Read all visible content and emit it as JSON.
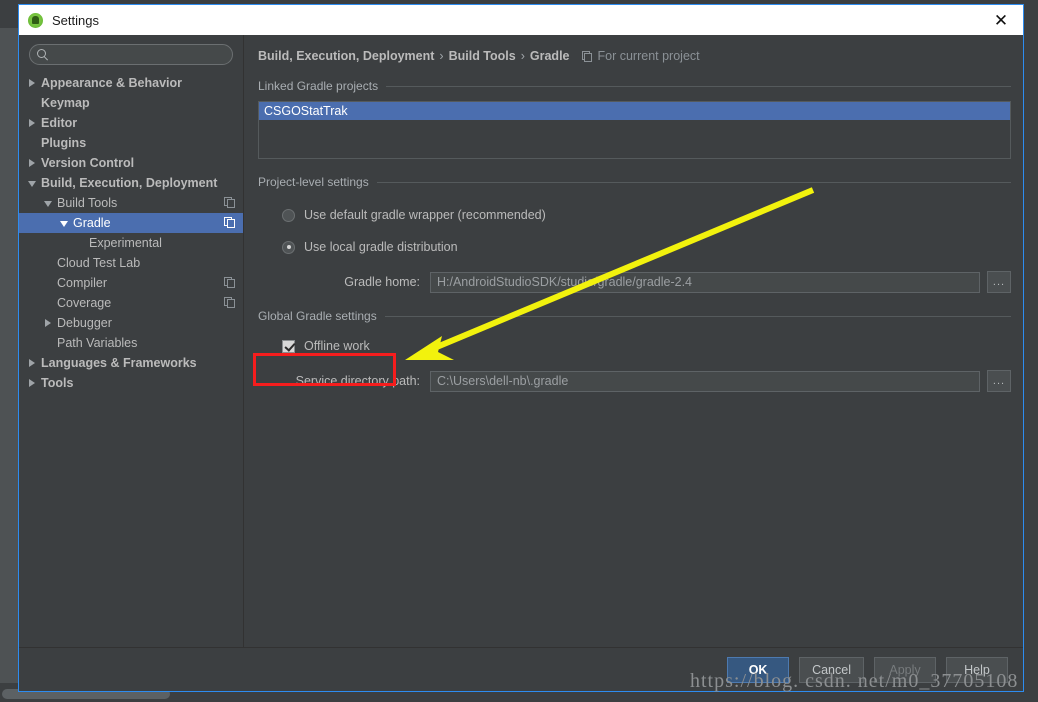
{
  "window": {
    "title": "Settings",
    "app_icon": "android-studio-icon",
    "close_icon": "close-icon",
    "accent_border": "#2d8cf0"
  },
  "search": {
    "icon": "search-icon",
    "value": "",
    "placeholder": ""
  },
  "sidebar": {
    "items": [
      {
        "label": "Appearance & Behavior",
        "indent": 0,
        "arrow": "right",
        "bold": true,
        "copy": false,
        "selected": false
      },
      {
        "label": "Keymap",
        "indent": 0,
        "arrow": "none",
        "bold": true,
        "copy": false,
        "selected": false
      },
      {
        "label": "Editor",
        "indent": 0,
        "arrow": "right",
        "bold": true,
        "copy": false,
        "selected": false
      },
      {
        "label": "Plugins",
        "indent": 0,
        "arrow": "none",
        "bold": true,
        "copy": false,
        "selected": false
      },
      {
        "label": "Version Control",
        "indent": 0,
        "arrow": "right",
        "bold": true,
        "copy": false,
        "selected": false
      },
      {
        "label": "Build, Execution, Deployment",
        "indent": 0,
        "arrow": "down",
        "bold": true,
        "copy": false,
        "selected": false
      },
      {
        "label": "Build Tools",
        "indent": 1,
        "arrow": "down",
        "bold": false,
        "copy": true,
        "selected": false
      },
      {
        "label": "Gradle",
        "indent": 2,
        "arrow": "down",
        "bold": false,
        "copy": true,
        "selected": true
      },
      {
        "label": "Experimental",
        "indent": 3,
        "arrow": "none",
        "bold": false,
        "copy": false,
        "selected": false
      },
      {
        "label": "Cloud Test Lab",
        "indent": 1,
        "arrow": "none",
        "bold": false,
        "copy": false,
        "selected": false
      },
      {
        "label": "Compiler",
        "indent": 1,
        "arrow": "none",
        "bold": false,
        "copy": true,
        "selected": false
      },
      {
        "label": "Coverage",
        "indent": 1,
        "arrow": "none",
        "bold": false,
        "copy": true,
        "selected": false
      },
      {
        "label": "Debugger",
        "indent": 1,
        "arrow": "right",
        "bold": false,
        "copy": false,
        "selected": false
      },
      {
        "label": "Path Variables",
        "indent": 1,
        "arrow": "none",
        "bold": false,
        "copy": false,
        "selected": false
      },
      {
        "label": "Languages & Frameworks",
        "indent": 0,
        "arrow": "right",
        "bold": true,
        "copy": false,
        "selected": false
      },
      {
        "label": "Tools",
        "indent": 0,
        "arrow": "right",
        "bold": true,
        "copy": false,
        "selected": false
      }
    ],
    "selection_color": "#4b6eaf"
  },
  "breadcrumb": {
    "crumbs": [
      "Build, Execution, Deployment",
      "Build Tools",
      "Gradle"
    ],
    "separator": "›",
    "scope_icon": "project-scope-icon",
    "scope_text": "For current project"
  },
  "main": {
    "linked_projects": {
      "section_label": "Linked Gradle projects",
      "items": [
        "CSGOStatTrak"
      ],
      "selected_index": 0
    },
    "project_level": {
      "section_label": "Project-level settings",
      "radios": [
        {
          "label": "Use default gradle wrapper (recommended)",
          "checked": false
        },
        {
          "label": "Use local gradle distribution",
          "checked": true
        }
      ],
      "gradle_home": {
        "label": "Gradle home:",
        "value": "H:/AndroidStudioSDK/studio/gradle/gradle-2.4",
        "browse_label": "...",
        "browse_icon": "ellipsis-icon"
      }
    },
    "global_settings": {
      "section_label": "Global Gradle settings",
      "offline_work": {
        "label": "Offline work",
        "checked": true
      },
      "service_directory": {
        "label": "Service directory path:",
        "value": "C:\\Users\\dell-nb\\.gradle",
        "browse_label": "...",
        "browse_icon": "ellipsis-icon"
      }
    }
  },
  "footer": {
    "buttons": [
      {
        "label": "OK",
        "style": "primary"
      },
      {
        "label": "Cancel",
        "style": "normal"
      },
      {
        "label": "Apply",
        "style": "disabled"
      },
      {
        "label": "Help",
        "style": "normal"
      }
    ]
  },
  "annotations": {
    "arrow_color": "#f2f20d",
    "highlight_color": "#f61d1d",
    "watermark": "https://blog. csdn. net/m0_37705108"
  }
}
